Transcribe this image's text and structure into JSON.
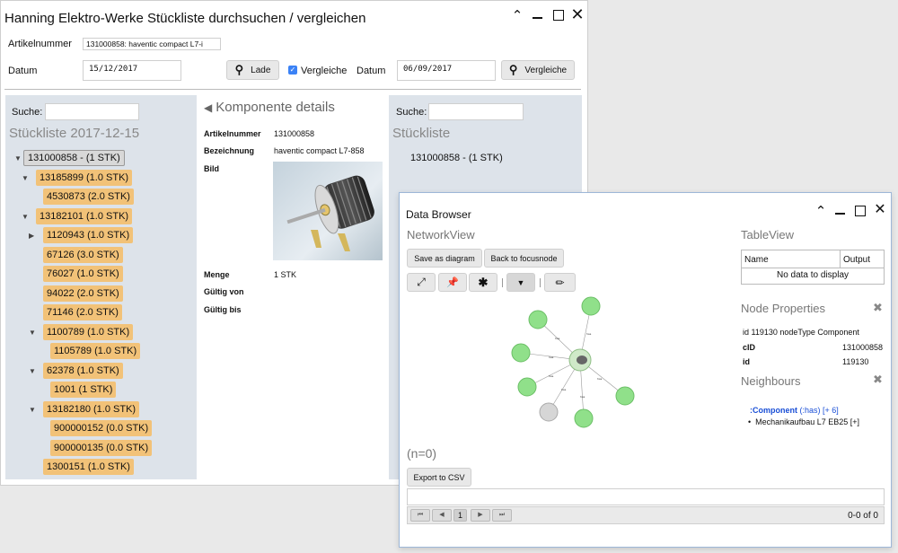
{
  "main": {
    "title": "Hanning Elektro-Werke Stückliste durchsuchen / vergleichen",
    "window_controls": [
      "chevron-up",
      "minimize",
      "maximize",
      "close"
    ],
    "form": {
      "artikel_label": "Artikelnummer",
      "artikel_value": "131000858: haventic compact L7-⁣i",
      "datum_label": "Datum",
      "datum_value": "15/12/2017",
      "lade_label": "Lade",
      "vergleiche_check_label": "Vergleiche",
      "datum2_label": "Datum",
      "datum2_value": "06/09/2017",
      "vergleiche_btn_label": "Vergleiche"
    },
    "left": {
      "search_label": "Suche:",
      "heading": "Stückliste 2017-12-15",
      "tree": [
        {
          "label": "131000858 - (1 STK)",
          "selected": true,
          "expanded": true
        },
        {
          "label": "13185899 (1.0 STK)",
          "expanded": true
        },
        {
          "label": "4530873 (2.0 STK)"
        },
        {
          "label": "13182101 (1.0 STK)",
          "expanded": true
        },
        {
          "label": "1120943 (1.0 STK)",
          "collapsed": true
        },
        {
          "label": "67126 (3.0 STK)"
        },
        {
          "label": "76027 (1.0 STK)"
        },
        {
          "label": "94022 (2.0 STK)"
        },
        {
          "label": "71146 (2.0 STK)"
        },
        {
          "label": "1100789 (1.0 STK)",
          "expanded": true
        },
        {
          "label": "1105789 (1.0 STK)"
        },
        {
          "label": "62378 (1.0 STK)",
          "expanded": true
        },
        {
          "label": "1001 (1 STK)"
        },
        {
          "label": "13182180 (1.0 STK)",
          "expanded": true
        },
        {
          "label": "900000152 (0.0 STK)"
        },
        {
          "label": "900000135 (0.0 STK)"
        },
        {
          "label": "1300151 (1.0 STK)"
        }
      ]
    },
    "details": {
      "heading": "Komponente details",
      "artikel_key": "Artikelnummer",
      "artikel_val": "131000858",
      "bez_key": "Bezeichnung",
      "bez_val": "haventic compact L7-858",
      "bild_key": "Bild",
      "menge_key": "Menge",
      "menge_val": "1 STK",
      "gueltig_von_key": "Gültig von",
      "gueltig_bis_key": "Gültig bis"
    },
    "right": {
      "search_label": "Suche:",
      "heading": "Stückliste",
      "root_item": "131000858 - (1 STK)"
    }
  },
  "databrowser": {
    "title": "Data Browser",
    "network_heading": "NetworkView",
    "save_diagram": "Save as diagram",
    "back_focus": "Back to focusnode",
    "toolbar_icons": [
      "expand-icon",
      "pin-icon",
      "asterisk-icon",
      "filter-icon",
      "brush-icon"
    ],
    "n_count": "(n=0)",
    "export_csv": "Export to CSV",
    "pager_page": "1",
    "pager_info": "0-0 of 0",
    "table_heading": "TableView",
    "table_cols": [
      "Name",
      "Output"
    ],
    "table_empty": "No data to display",
    "props_heading": "Node Properties",
    "props_summary": "id 119130 nodeType Component",
    "props_cid_key": "cID",
    "props_cid_val": "131000858",
    "props_id_key": "id",
    "props_id_val": "119130",
    "neighbours_heading": "Neighbours",
    "neighbour_type": ":Component",
    "neighbour_rel": "(:has)",
    "neighbour_more": "[+ 6]",
    "neighbour_item": "Mechanikaufbau L7 EB25 [+]"
  },
  "colors": {
    "tree_node": "#f2c278",
    "panel_bg": "#dde3ea",
    "graph_node": "#90e08a",
    "link_blue": "#1a4fd6"
  }
}
